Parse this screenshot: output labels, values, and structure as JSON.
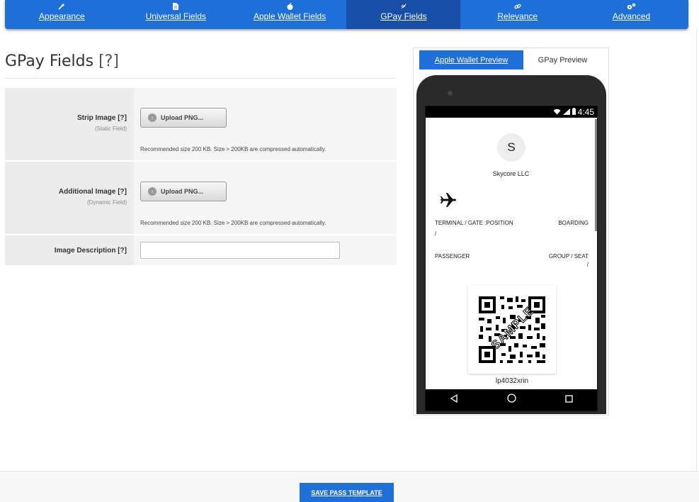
{
  "nav": {
    "tabs": [
      {
        "label": "Appearance",
        "icon": "magic-wand-icon"
      },
      {
        "label": "Universal Fields",
        "icon": "document-icon"
      },
      {
        "label": "Apple Wallet Fields",
        "icon": "apple-icon"
      },
      {
        "label": "GPay Fields",
        "icon": "gpay-icon"
      },
      {
        "label": "Relevance",
        "icon": "link-icon"
      },
      {
        "label": "Advanced",
        "icon": "gears-icon"
      }
    ],
    "active": "GPay Fields"
  },
  "page": {
    "title": "GPay Fields",
    "help": "[?]"
  },
  "form": {
    "strip_image": {
      "label": "Strip Image",
      "help": "[?]",
      "sublabel": "(Static Field)",
      "button": "Upload PNG...",
      "note": "Recommended size 200 KB. Size > 200KB are compressed automatically."
    },
    "additional_image": {
      "label": "Additional Image",
      "help": "[?]",
      "sublabel": "(Dynamic Field)",
      "button": "Upload PNG...",
      "note": "Recommended size 200 KB. Size > 200KB are compressed automatically."
    },
    "image_description": {
      "label": "Image Description",
      "help": "[?]",
      "value": ""
    }
  },
  "preview": {
    "tabs": {
      "apple": "Apple Wallet Preview",
      "gpay": "GPay Preview"
    },
    "status_time": "4:45",
    "card": {
      "avatar_letter": "S",
      "company": "Skycore LLC",
      "terminal_label": "TERMINAL / GATE :POSITION",
      "terminal_value": "/",
      "boarding_label": "BOARDING",
      "passenger_label": "PASSENGER",
      "group_label": "GROUP / SEAT",
      "group_value": "/",
      "qr_watermark": "SAMPLE",
      "barcode_text": "lp4032xrin"
    }
  },
  "footer": {
    "save_label": "SAVE PASS TEMPLATE"
  },
  "colors": {
    "primary": "#1f6fd9",
    "active_tab": "#174fa8"
  }
}
